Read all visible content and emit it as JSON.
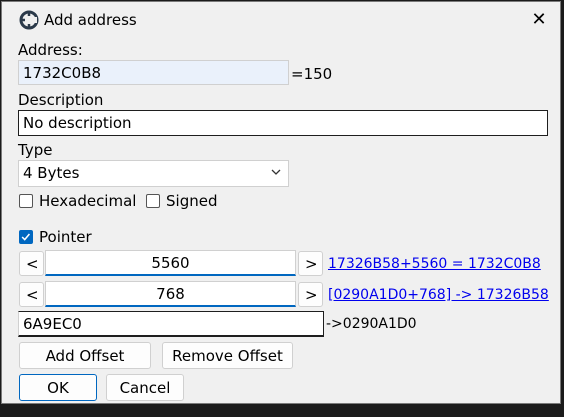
{
  "window": {
    "title": "Add address"
  },
  "address": {
    "label": "Address:",
    "value": "1732C0B8",
    "eq_text": "=150"
  },
  "description": {
    "label": "Description",
    "value": "No description"
  },
  "type": {
    "label": "Type",
    "selected": "4 Bytes"
  },
  "options": {
    "hexadecimal": "Hexadecimal",
    "signed": "Signed"
  },
  "pointer": {
    "label": "Pointer",
    "offsets": [
      {
        "value": "5560",
        "link": "17326B58+5560 = 1732C0B8"
      },
      {
        "value": "768",
        "link": "[0290A1D0+768] -> 17326B58"
      }
    ],
    "base_value": "6A9EC0",
    "base_result": "->0290A1D0",
    "prev": "<",
    "next": ">"
  },
  "buttons": {
    "add_offset": "Add Offset",
    "remove_offset": "Remove Offset",
    "ok": "OK",
    "cancel": "Cancel"
  }
}
